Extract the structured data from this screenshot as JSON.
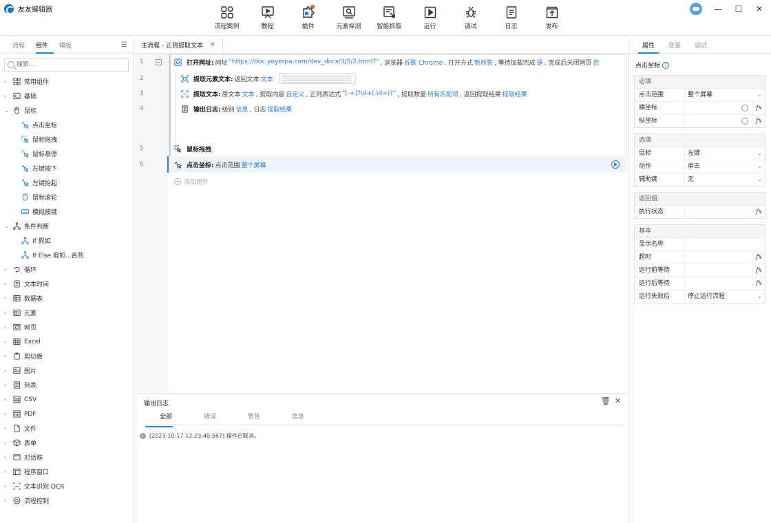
{
  "app": {
    "title": "友友编辑器"
  },
  "toolbar": [
    {
      "name": "cases",
      "label": "流程案例",
      "icon": "grid-icon"
    },
    {
      "name": "tutorial",
      "label": "教程",
      "icon": "presentation-icon"
    },
    {
      "name": "plugin",
      "label": "插件",
      "icon": "plugin-icon"
    },
    {
      "name": "element-detect",
      "label": "元素探测",
      "icon": "detect-icon"
    },
    {
      "name": "smart-capture",
      "label": "智能抓取",
      "icon": "capture-icon"
    },
    {
      "name": "run",
      "label": "运行",
      "icon": "play-icon"
    },
    {
      "name": "debug",
      "label": "调试",
      "icon": "bug-icon"
    },
    {
      "name": "log",
      "label": "日志",
      "icon": "document-icon"
    },
    {
      "name": "publish",
      "label": "发布",
      "icon": "upload-icon"
    }
  ],
  "left": {
    "tabs": [
      "流程",
      "组件",
      "模板"
    ],
    "active_tab": "组件",
    "search_placeholder": "搜索...",
    "tree": [
      {
        "label": "常用组件",
        "arrow": "›",
        "icon": "grid"
      },
      {
        "label": "基础",
        "arrow": "›",
        "icon": "terminal"
      },
      {
        "label": "鼠标",
        "arrow": "⌄",
        "icon": "mouse"
      },
      {
        "label": "点击坐标",
        "sub": true,
        "icon": "click"
      },
      {
        "label": "鼠标拖拽",
        "sub": true,
        "icon": "drag"
      },
      {
        "label": "鼠标悬停",
        "sub": true,
        "icon": "hover"
      },
      {
        "label": "左键按下",
        "sub": true,
        "icon": "press"
      },
      {
        "label": "左键抬起",
        "sub": true,
        "icon": "release"
      },
      {
        "label": "鼠标滚轮",
        "sub": true,
        "icon": "wheel"
      },
      {
        "label": "模拟按键",
        "sub": true,
        "icon": "keyboard"
      },
      {
        "label": "条件判断",
        "arrow": "⌄",
        "icon": "branch"
      },
      {
        "label": "If 假如",
        "sub": true,
        "icon": "branch"
      },
      {
        "label": "If Else 假如...否则",
        "sub": true,
        "icon": "branch"
      },
      {
        "label": "循环",
        "arrow": "›",
        "icon": "loop"
      },
      {
        "label": "文本时间",
        "arrow": "›",
        "icon": "doc"
      },
      {
        "label": "数据表",
        "arrow": "›",
        "icon": "table"
      },
      {
        "label": "元素",
        "arrow": "›",
        "icon": "element"
      },
      {
        "label": "网页",
        "arrow": "›",
        "icon": "web"
      },
      {
        "label": "Excel",
        "arrow": "›",
        "icon": "excel"
      },
      {
        "label": "剪切板",
        "arrow": "›",
        "icon": "clipboard"
      },
      {
        "label": "图片",
        "arrow": "›",
        "icon": "image"
      },
      {
        "label": "列表",
        "arrow": "›",
        "icon": "list"
      },
      {
        "label": "CSV",
        "arrow": "›",
        "icon": "csv"
      },
      {
        "label": "PDF",
        "arrow": "›",
        "icon": "pdf"
      },
      {
        "label": "文件",
        "arrow": "›",
        "icon": "file"
      },
      {
        "label": "表单",
        "arrow": "›",
        "icon": "cube"
      },
      {
        "label": "对话框",
        "arrow": "›",
        "icon": "dialog"
      },
      {
        "label": "程序窗口",
        "arrow": "›",
        "icon": "window"
      },
      {
        "label": "文本识别 OCR",
        "arrow": "›",
        "icon": "ocr"
      },
      {
        "label": "流程控制",
        "arrow": "›",
        "icon": "control"
      }
    ]
  },
  "editor": {
    "tab_label": "主流程 - 正则提取文本",
    "tab_close": "×",
    "line_numbers": [
      "1",
      "2",
      "3",
      "4",
      "5",
      "6"
    ],
    "fold_symbol": "−",
    "line1": {
      "cmd": "打开网址:",
      "t1": "网址",
      "url": "\"https://doc.yoyorpa.com/dev_docs/3/5/2.html?\"",
      "t2": ", 浏览器",
      "browser": "谷歌 Chrome",
      "t3": ", 打开方式",
      "open_mode": "新标签",
      "t4": ", 等待加载完成",
      "wait": "是",
      "t5": ", 完成后关闭网页",
      "close": "否"
    },
    "line2": {
      "cmd": "提取元素文本:",
      "t1": "返回文本",
      "ret": "文本"
    },
    "line3": {
      "cmd": "提取文本:",
      "t1": "原文本",
      "src": "文本",
      "t2": ", 提取内容",
      "content": "自定义",
      "t3": ", 正则表达式",
      "regex": "\"[-+]?\\d+(.\\d+)?\"",
      "t4": ", 提取数量",
      "count": "所有匹配项",
      "t5": ", 返回提取结果",
      "result": "提取结果"
    },
    "line4": {
      "cmd": "输出日志:",
      "t1": "级别",
      "level": "信息",
      "t2": ", 日志",
      "log": "提取结果"
    },
    "line5": {
      "cmd": "鼠标拖拽"
    },
    "line6": {
      "cmd": "点击坐标:",
      "t1": "点击范围",
      "range": "整个屏幕"
    },
    "add_component": "添加组件"
  },
  "log": {
    "title": "输出日志",
    "tabs": [
      "全部",
      "错误",
      "警告",
      "信息"
    ],
    "active_tab": "全部",
    "entries": [
      {
        "text": "[2023-10-17 12:23:40:567] 操作已取消。"
      }
    ]
  },
  "right": {
    "tabs": [
      "属性",
      "变量",
      "调试"
    ],
    "active_tab": "属性",
    "title": "点击坐标",
    "help": "?",
    "groups": {
      "required": {
        "title": "必填",
        "rows": [
          {
            "key": "点击范围",
            "value": "整个屏幕"
          },
          {
            "key": "横坐标",
            "value": ""
          },
          {
            "key": "纵坐标",
            "value": ""
          }
        ]
      },
      "options": {
        "title": "选填",
        "rows": [
          {
            "key": "鼠标",
            "value": "左键"
          },
          {
            "key": "动作",
            "value": "单击"
          },
          {
            "key": "辅助键",
            "value": "无"
          }
        ]
      },
      "returns": {
        "title": "返回值",
        "rows": [
          {
            "key": "执行状态",
            "value": ""
          }
        ]
      },
      "basic": {
        "title": "基本",
        "rows": [
          {
            "key": "显示名称",
            "value": ""
          },
          {
            "key": "超时",
            "value": ""
          },
          {
            "key": "运行前等待",
            "value": ""
          },
          {
            "key": "运行后等待",
            "value": ""
          },
          {
            "key": "运行失败后",
            "value": "停止运行流程"
          }
        ]
      }
    }
  },
  "glyphs": {
    "fx": "fx",
    "dropdown": "⌄",
    "trash": "🗑",
    "close": "✕",
    "minimize": "—",
    "maximize": "☐",
    "info": "i"
  },
  "colors": {
    "accent": "#2a7de1",
    "selected_row": "#eef4fc",
    "badge": "#f5532e"
  }
}
